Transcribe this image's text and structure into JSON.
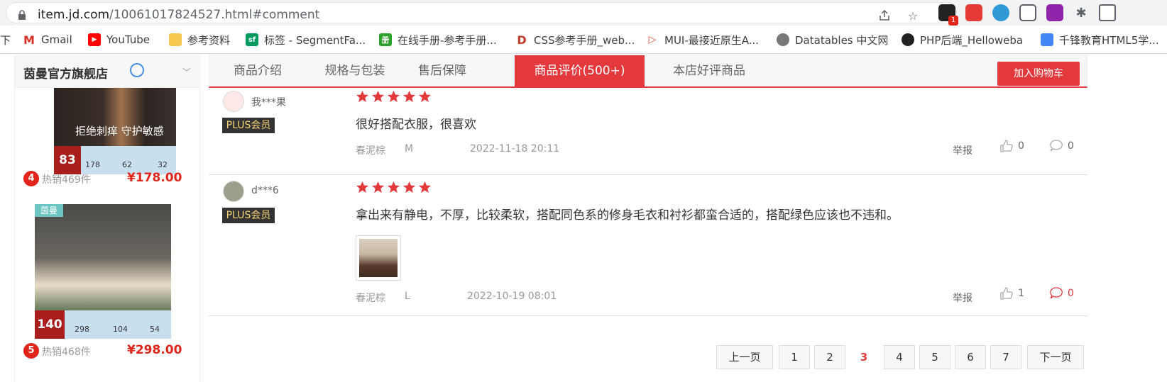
{
  "browser": {
    "url_host": "item.jd.com",
    "url_path": "/10061017824527.html#comment",
    "ext_badge": "1"
  },
  "bookmarks": {
    "partial": "下",
    "items": [
      "Gmail",
      "YouTube",
      "参考资料",
      "标签 - SegmentFa...",
      "在线手册-参考手册...",
      "CSS参考手册_web...",
      "MUI-最接近原生A...",
      "Datatables 中文网",
      "PHP后端_Helloweba",
      "千锋教育HTML5学..."
    ]
  },
  "shop": {
    "name": "茵曼官方旗舰店",
    "products": [
      {
        "rank": "4",
        "sold": "热销469件",
        "price": "¥178.00",
        "overlay": "拒绝刺痒 守护敏感",
        "badge_num": "83",
        "nums": [
          "178",
          "62",
          "32"
        ]
      },
      {
        "rank": "5",
        "sold": "热销468件",
        "price": "¥298.00",
        "tag": "茵曼",
        "badge_num": "140",
        "nums": [
          "298",
          "104",
          "54"
        ]
      }
    ]
  },
  "tabs": [
    {
      "label": "商品介绍",
      "active": false
    },
    {
      "label": "规格与包装",
      "active": false
    },
    {
      "label": "售后保障",
      "active": false
    },
    {
      "label": "商品评价(500+)",
      "active": true
    },
    {
      "label": "本店好评商品",
      "active": false
    }
  ],
  "cart_label": "加入购物车",
  "plus_label": "PLUS会员",
  "reviews": [
    {
      "user": "我***果",
      "stars": 5,
      "text": "很好搭配衣服，很喜欢",
      "color": "春泥棕",
      "size": "M",
      "date": "2022-11-18 20:11",
      "report": "举报",
      "likes": "0",
      "replies": "0"
    },
    {
      "user": "d***6",
      "stars": 5,
      "text": "拿出来有静电，不厚，比较柔软，搭配同色系的修身毛衣和衬衫都蛮合适的，搭配绿色应该也不违和。",
      "color": "春泥棕",
      "size": "L",
      "date": "2022-10-19 08:01",
      "report": "举报",
      "likes": "1",
      "replies": "0"
    }
  ],
  "pagination": {
    "prev": "上一页",
    "pages": [
      "1",
      "2",
      "3",
      "4",
      "5",
      "6",
      "7"
    ],
    "current": "3",
    "next": "下一页"
  },
  "colors": {
    "accent": "#e4393c",
    "plus_gold": "#f5d375"
  }
}
